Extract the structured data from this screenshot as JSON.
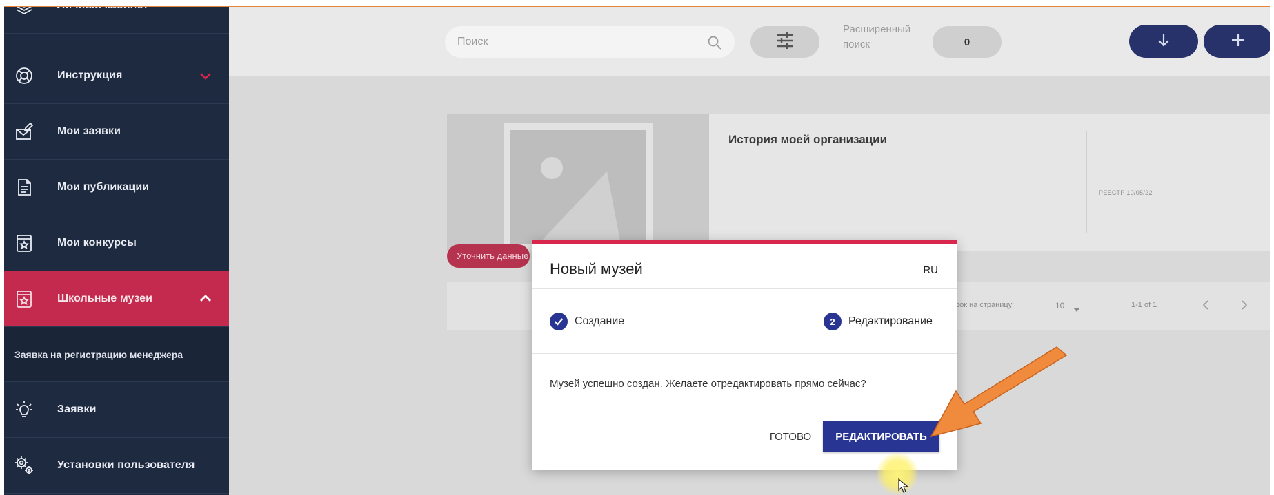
{
  "sidebar": {
    "items": [
      {
        "label": "Личный кабинет",
        "icon": "layers-icon"
      },
      {
        "label": "Инструкция",
        "icon": "lifebuoy-icon"
      },
      {
        "label": "Мои заявки",
        "icon": "mail-edit-icon"
      },
      {
        "label": "Мои публикации",
        "icon": "document-icon"
      },
      {
        "label": "Мои конкурсы",
        "icon": "award-icon"
      },
      {
        "label": "Школьные музеи",
        "icon": "museum-icon"
      },
      {
        "label": "Заявка на регистрацию менеджера",
        "icon": ""
      },
      {
        "label": "Заявки",
        "icon": "bulb-icon"
      },
      {
        "label": "Установки пользователя",
        "icon": "settings-icon"
      }
    ]
  },
  "toolbar": {
    "search_placeholder": "Поиск",
    "advanced_search_label": "Расширенный поиск",
    "filter_count": "0"
  },
  "card": {
    "title": "История моей организации",
    "meta": "РЕЕСТР 10/05/22",
    "chip": "Уточнить данные"
  },
  "pagination": {
    "rows_label": "трок на страницу:",
    "rows_value": "10",
    "range": "1-1 of 1"
  },
  "dialog": {
    "title": "Новый музей",
    "lang": "RU",
    "step1": "Создание",
    "step2_number": "2",
    "step2": "Редактирование",
    "message": "Музей успешно создан. Желаете отредактировать прямо сейчас?",
    "done_label": "ГОТОВО",
    "edit_label": "РЕДАКТИРОВАТЬ"
  },
  "colors": {
    "sidebar_bg": "#1e2a3f",
    "sidebar_active": "#c42a4e",
    "primary": "#283593",
    "accent_top": "#d8264d",
    "annotation_arrow": "#f08a3c"
  }
}
